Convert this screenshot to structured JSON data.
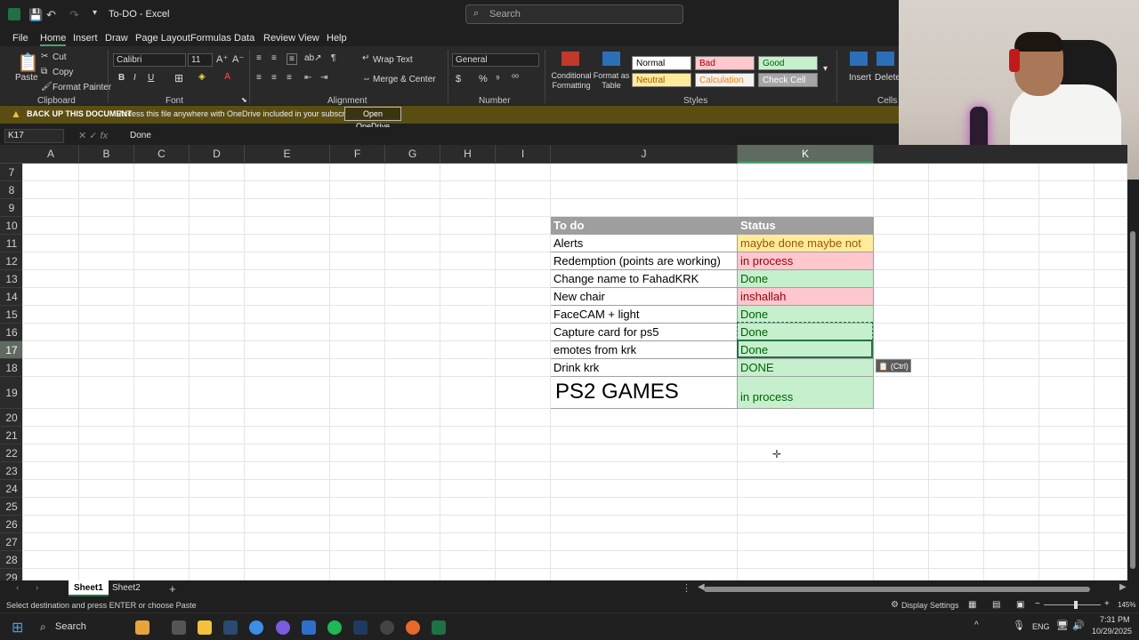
{
  "window": {
    "title": "To-DO  -  Excel",
    "search_placeholder": "Search"
  },
  "menu": [
    "File",
    "Home",
    "Insert",
    "Draw",
    "Page Layout",
    "Formulas",
    "Data",
    "Review",
    "View",
    "Help"
  ],
  "active_menu": "Home",
  "ribbon": {
    "paste": "Paste",
    "cut": "Cut",
    "copy": "Copy",
    "format_painter": "Format Painter",
    "clipboard": "Clipboard",
    "font_name": "Calibri",
    "font_size": "11",
    "font": "Font",
    "wrap_text": "Wrap Text",
    "merge_center": "Merge & Center",
    "alignment": "Alignment",
    "number_format": "General",
    "number": "Number",
    "conditional_formatting": "Conditional Formatting",
    "format_as_table": "Format as Table",
    "styles": "Styles",
    "style_cells": [
      {
        "label": "Normal",
        "bg": "#ffffff",
        "fg": "#000000"
      },
      {
        "label": "Bad",
        "bg": "#ffc7ce",
        "fg": "#9c0006"
      },
      {
        "label": "Good",
        "bg": "#c6efce",
        "fg": "#006100"
      },
      {
        "label": "Neutral",
        "bg": "#ffeb9c",
        "fg": "#9c5700"
      },
      {
        "label": "Calculation",
        "bg": "#f2f2f2",
        "fg": "#fa7d00"
      },
      {
        "label": "Check Cell",
        "bg": "#a5a5a5",
        "fg": "#ffffff"
      }
    ],
    "insert": "Insert",
    "delete": "Delete",
    "cells": "Cells"
  },
  "warning": {
    "title": "BACK UP THIS DOCUMENT",
    "message": "Access this file anywhere with OneDrive included in your subscription.",
    "button": "Open OneDrive"
  },
  "formula_bar": {
    "name_box": "K17",
    "value": "Done"
  },
  "columns": [
    "A",
    "B",
    "C",
    "D",
    "E",
    "F",
    "G",
    "H",
    "I",
    "J",
    "K"
  ],
  "rows": [
    "7",
    "8",
    "9",
    "10",
    "11",
    "12",
    "13",
    "14",
    "15",
    "16",
    "17",
    "18",
    "19",
    "20",
    "21",
    "22",
    "23",
    "24",
    "25",
    "26",
    "27",
    "28",
    "29"
  ],
  "table": {
    "header": {
      "task": "To do",
      "status": "Status"
    },
    "rows": [
      {
        "task": "Alerts",
        "status": "maybe done maybe not",
        "style": "yellow"
      },
      {
        "task": "Redemption (points are working)",
        "status": "in process",
        "style": "red"
      },
      {
        "task": "Change name to FahadKRK",
        "status": "Done",
        "style": "green"
      },
      {
        "task": "New chair",
        "status": "inshallah",
        "style": "red"
      },
      {
        "task": "FaceCAM + light",
        "status": "Done",
        "style": "green"
      },
      {
        "task": "Capture card for ps5",
        "status": "Done",
        "style": "green"
      },
      {
        "task": "emotes from krk",
        "status": "Done",
        "style": "green"
      },
      {
        "task": "Drink krk",
        "status": "DONE",
        "style": "green"
      },
      {
        "task": "PS2 GAMES",
        "status": "in process",
        "style": "green"
      }
    ]
  },
  "paste_options": "(Ctrl)",
  "sheets": [
    "Sheet1",
    "Sheet2"
  ],
  "active_sheet": "Sheet1",
  "status": {
    "message": "Select destination and press ENTER or choose Paste",
    "display_settings": "Display Settings",
    "zoom": "145%"
  },
  "taskbar": {
    "search": "Search",
    "lang": "ENG",
    "time": "7:31 PM",
    "date": "10/29/2025"
  }
}
